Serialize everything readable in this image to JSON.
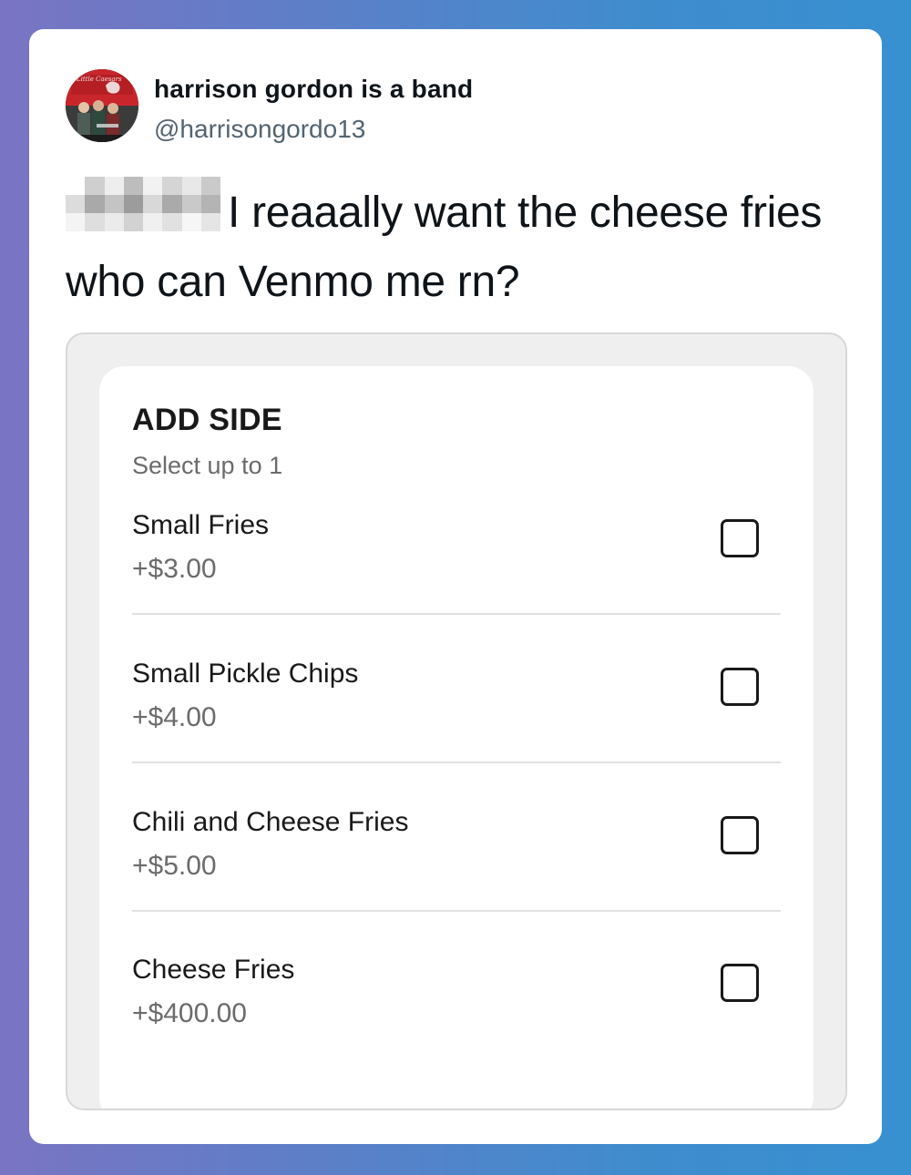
{
  "tweet": {
    "display_name": "harrison gordon is a band",
    "handle": "@harrisongordo13",
    "text": "I reaaally want the cheese fries who can Venmo me rn?",
    "avatar_sign_text": "Little Caesars"
  },
  "embedded_screenshot": {
    "title": "ADD SIDE",
    "subtitle": "Select up to 1",
    "options": [
      {
        "name": "Small Fries",
        "price": "+$3.00",
        "checked": false
      },
      {
        "name": "Small Pickle Chips",
        "price": "+$4.00",
        "checked": false
      },
      {
        "name": "Chili and Cheese Fries",
        "price": "+$5.00",
        "checked": false
      },
      {
        "name": "Cheese Fries",
        "price": "+$400.00",
        "checked": false
      }
    ]
  },
  "colors": {
    "background_gradient_start": "#7a74c3",
    "background_gradient_end": "#3790d0",
    "text_primary": "#0f1419",
    "text_secondary": "#536471"
  },
  "icons": {
    "checkbox": "checkbox-empty-icon"
  }
}
